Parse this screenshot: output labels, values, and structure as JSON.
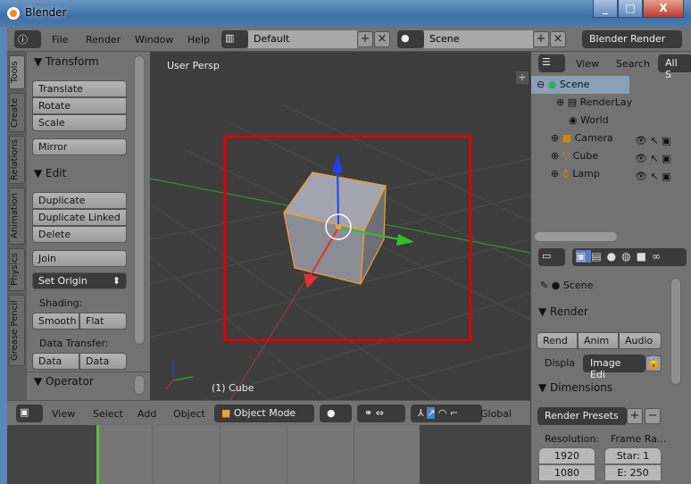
{
  "window": {
    "title": "Blender",
    "minimize": "_",
    "maximize": "□",
    "close": "X"
  },
  "menubar": {
    "items": [
      "File",
      "Render",
      "Window",
      "Help"
    ],
    "layout": "Default",
    "scene": "Scene",
    "engine": "Blender Render"
  },
  "tool_tabs": [
    "Tools",
    "Create",
    "Relations",
    "Animation",
    "Physics",
    "Grease Pencil"
  ],
  "tools": {
    "transform_header": "Transform",
    "translate": "Translate",
    "rotate": "Rotate",
    "scale": "Scale",
    "mirror": "Mirror",
    "edit_header": "Edit",
    "duplicate": "Duplicate",
    "duplicate_linked": "Duplicate Linked",
    "delete": "Delete",
    "join": "Join",
    "set_origin": "Set Origin",
    "shading_label": "Shading:",
    "smooth": "Smooth",
    "flat": "Flat",
    "data_transfer_label": "Data Transfer:",
    "data": "Data",
    "data_la": "Data La",
    "operator_header": "Operator"
  },
  "viewport": {
    "view_label": "User Persp",
    "object_label": "(1) Cube"
  },
  "view_header": {
    "items": [
      "View",
      "Select",
      "Add",
      "Object"
    ],
    "mode": "Object Mode",
    "orientation": "Global"
  },
  "outliner": {
    "view": "View",
    "search": "Search",
    "filter": "All S",
    "items": [
      {
        "label": "Scene",
        "level": 0
      },
      {
        "label": "RenderLay",
        "level": 1
      },
      {
        "label": "World",
        "level": 1
      },
      {
        "label": "Camera",
        "level": 1
      },
      {
        "label": "Cube",
        "level": 1
      },
      {
        "label": "Lamp",
        "level": 1
      }
    ]
  },
  "properties": {
    "context": "Scene",
    "render_header": "Render",
    "rend": "Rend",
    "anim": "Anim",
    "audio": "Audio",
    "display_label": "Displa",
    "display_value": "Image Edi",
    "dimensions_header": "Dimensions",
    "presets": "Render Presets",
    "resolution_label": "Resolution:",
    "frame_range_label": "Frame Ra...",
    "res_x": "1920",
    "res_y": "1080",
    "start": "Star: 1",
    "end": "E: 250"
  },
  "colors": {
    "selection_box": "#e00000",
    "x_axis": "#e03030",
    "y_axis": "#30c030",
    "z_axis": "#2040f0",
    "selected_outline": "#f0a030"
  }
}
